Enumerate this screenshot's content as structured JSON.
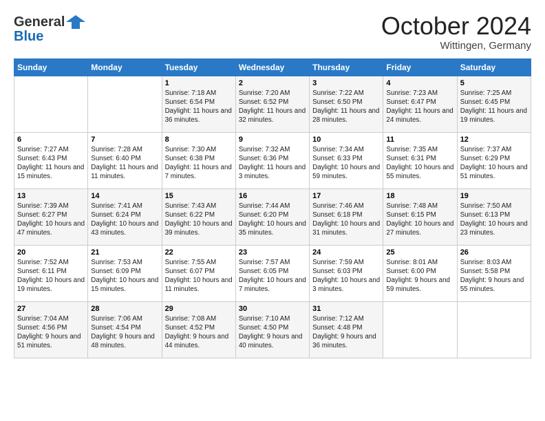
{
  "header": {
    "logo_general": "General",
    "logo_blue": "Blue",
    "month": "October 2024",
    "location": "Wittingen, Germany"
  },
  "days_of_week": [
    "Sunday",
    "Monday",
    "Tuesday",
    "Wednesday",
    "Thursday",
    "Friday",
    "Saturday"
  ],
  "weeks": [
    [
      {
        "day": "",
        "sunrise": "",
        "sunset": "",
        "daylight": ""
      },
      {
        "day": "",
        "sunrise": "",
        "sunset": "",
        "daylight": ""
      },
      {
        "day": "1",
        "sunrise": "Sunrise: 7:18 AM",
        "sunset": "Sunset: 6:54 PM",
        "daylight": "Daylight: 11 hours and 36 minutes."
      },
      {
        "day": "2",
        "sunrise": "Sunrise: 7:20 AM",
        "sunset": "Sunset: 6:52 PM",
        "daylight": "Daylight: 11 hours and 32 minutes."
      },
      {
        "day": "3",
        "sunrise": "Sunrise: 7:22 AM",
        "sunset": "Sunset: 6:50 PM",
        "daylight": "Daylight: 11 hours and 28 minutes."
      },
      {
        "day": "4",
        "sunrise": "Sunrise: 7:23 AM",
        "sunset": "Sunset: 6:47 PM",
        "daylight": "Daylight: 11 hours and 24 minutes."
      },
      {
        "day": "5",
        "sunrise": "Sunrise: 7:25 AM",
        "sunset": "Sunset: 6:45 PM",
        "daylight": "Daylight: 11 hours and 19 minutes."
      }
    ],
    [
      {
        "day": "6",
        "sunrise": "Sunrise: 7:27 AM",
        "sunset": "Sunset: 6:43 PM",
        "daylight": "Daylight: 11 hours and 15 minutes."
      },
      {
        "day": "7",
        "sunrise": "Sunrise: 7:28 AM",
        "sunset": "Sunset: 6:40 PM",
        "daylight": "Daylight: 11 hours and 11 minutes."
      },
      {
        "day": "8",
        "sunrise": "Sunrise: 7:30 AM",
        "sunset": "Sunset: 6:38 PM",
        "daylight": "Daylight: 11 hours and 7 minutes."
      },
      {
        "day": "9",
        "sunrise": "Sunrise: 7:32 AM",
        "sunset": "Sunset: 6:36 PM",
        "daylight": "Daylight: 11 hours and 3 minutes."
      },
      {
        "day": "10",
        "sunrise": "Sunrise: 7:34 AM",
        "sunset": "Sunset: 6:33 PM",
        "daylight": "Daylight: 10 hours and 59 minutes."
      },
      {
        "day": "11",
        "sunrise": "Sunrise: 7:35 AM",
        "sunset": "Sunset: 6:31 PM",
        "daylight": "Daylight: 10 hours and 55 minutes."
      },
      {
        "day": "12",
        "sunrise": "Sunrise: 7:37 AM",
        "sunset": "Sunset: 6:29 PM",
        "daylight": "Daylight: 10 hours and 51 minutes."
      }
    ],
    [
      {
        "day": "13",
        "sunrise": "Sunrise: 7:39 AM",
        "sunset": "Sunset: 6:27 PM",
        "daylight": "Daylight: 10 hours and 47 minutes."
      },
      {
        "day": "14",
        "sunrise": "Sunrise: 7:41 AM",
        "sunset": "Sunset: 6:24 PM",
        "daylight": "Daylight: 10 hours and 43 minutes."
      },
      {
        "day": "15",
        "sunrise": "Sunrise: 7:43 AM",
        "sunset": "Sunset: 6:22 PM",
        "daylight": "Daylight: 10 hours and 39 minutes."
      },
      {
        "day": "16",
        "sunrise": "Sunrise: 7:44 AM",
        "sunset": "Sunset: 6:20 PM",
        "daylight": "Daylight: 10 hours and 35 minutes."
      },
      {
        "day": "17",
        "sunrise": "Sunrise: 7:46 AM",
        "sunset": "Sunset: 6:18 PM",
        "daylight": "Daylight: 10 hours and 31 minutes."
      },
      {
        "day": "18",
        "sunrise": "Sunrise: 7:48 AM",
        "sunset": "Sunset: 6:15 PM",
        "daylight": "Daylight: 10 hours and 27 minutes."
      },
      {
        "day": "19",
        "sunrise": "Sunrise: 7:50 AM",
        "sunset": "Sunset: 6:13 PM",
        "daylight": "Daylight: 10 hours and 23 minutes."
      }
    ],
    [
      {
        "day": "20",
        "sunrise": "Sunrise: 7:52 AM",
        "sunset": "Sunset: 6:11 PM",
        "daylight": "Daylight: 10 hours and 19 minutes."
      },
      {
        "day": "21",
        "sunrise": "Sunrise: 7:53 AM",
        "sunset": "Sunset: 6:09 PM",
        "daylight": "Daylight: 10 hours and 15 minutes."
      },
      {
        "day": "22",
        "sunrise": "Sunrise: 7:55 AM",
        "sunset": "Sunset: 6:07 PM",
        "daylight": "Daylight: 10 hours and 11 minutes."
      },
      {
        "day": "23",
        "sunrise": "Sunrise: 7:57 AM",
        "sunset": "Sunset: 6:05 PM",
        "daylight": "Daylight: 10 hours and 7 minutes."
      },
      {
        "day": "24",
        "sunrise": "Sunrise: 7:59 AM",
        "sunset": "Sunset: 6:03 PM",
        "daylight": "Daylight: 10 hours and 3 minutes."
      },
      {
        "day": "25",
        "sunrise": "Sunrise: 8:01 AM",
        "sunset": "Sunset: 6:00 PM",
        "daylight": "Daylight: 9 hours and 59 minutes."
      },
      {
        "day": "26",
        "sunrise": "Sunrise: 8:03 AM",
        "sunset": "Sunset: 5:58 PM",
        "daylight": "Daylight: 9 hours and 55 minutes."
      }
    ],
    [
      {
        "day": "27",
        "sunrise": "Sunrise: 7:04 AM",
        "sunset": "Sunset: 4:56 PM",
        "daylight": "Daylight: 9 hours and 51 minutes."
      },
      {
        "day": "28",
        "sunrise": "Sunrise: 7:06 AM",
        "sunset": "Sunset: 4:54 PM",
        "daylight": "Daylight: 9 hours and 48 minutes."
      },
      {
        "day": "29",
        "sunrise": "Sunrise: 7:08 AM",
        "sunset": "Sunset: 4:52 PM",
        "daylight": "Daylight: 9 hours and 44 minutes."
      },
      {
        "day": "30",
        "sunrise": "Sunrise: 7:10 AM",
        "sunset": "Sunset: 4:50 PM",
        "daylight": "Daylight: 9 hours and 40 minutes."
      },
      {
        "day": "31",
        "sunrise": "Sunrise: 7:12 AM",
        "sunset": "Sunset: 4:48 PM",
        "daylight": "Daylight: 9 hours and 36 minutes."
      },
      {
        "day": "",
        "sunrise": "",
        "sunset": "",
        "daylight": ""
      },
      {
        "day": "",
        "sunrise": "",
        "sunset": "",
        "daylight": ""
      }
    ]
  ]
}
